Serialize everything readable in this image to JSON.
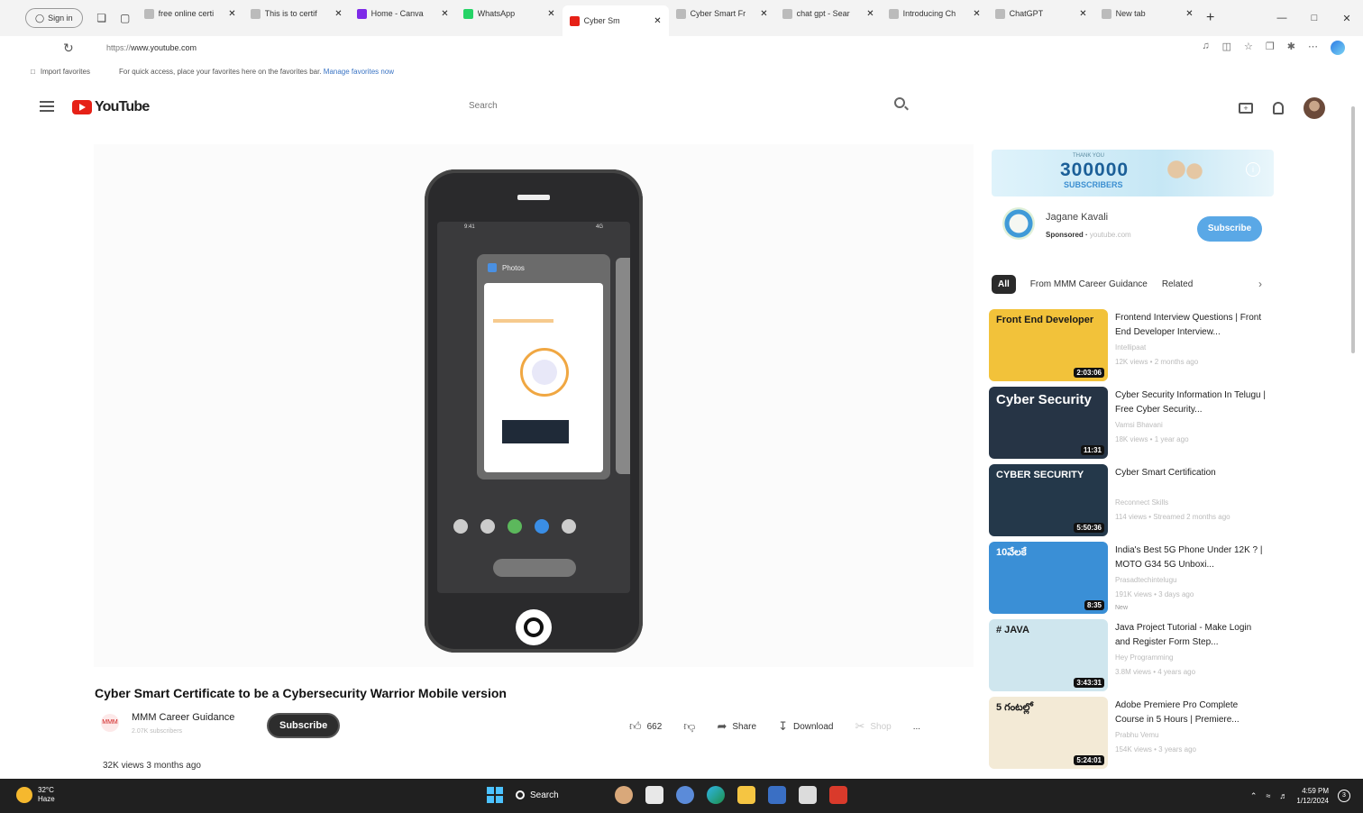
{
  "browser": {
    "signin_label": "Sign in",
    "tabs": [
      {
        "title": "free online certi",
        "favicon": "doc-icon",
        "active": false
      },
      {
        "title": "This is to certif",
        "favicon": "page-icon",
        "active": false
      },
      {
        "title": "Home - Canva",
        "favicon": "canva-icon",
        "active": false
      },
      {
        "title": "WhatsApp",
        "favicon": "whatsapp-icon",
        "active": false
      },
      {
        "title": "Cyber Sm",
        "favicon": "youtube-icon",
        "active": true
      },
      {
        "title": "Cyber Smart Fr",
        "favicon": "doc-icon",
        "active": false
      },
      {
        "title": "chat gpt - Sear",
        "favicon": "search-icon",
        "active": false
      },
      {
        "title": "Introducing Ch",
        "favicon": "page-icon",
        "active": false
      },
      {
        "title": "ChatGPT",
        "favicon": "chatgpt-icon",
        "active": false
      },
      {
        "title": "New tab",
        "favicon": "newtab-icon",
        "active": false
      }
    ],
    "url_prefix": "https://",
    "url_domain": "www.youtube.com",
    "favorites_import": "Import favorites",
    "favorites_hint": "For quick access, place your favorites here on the favorites bar.",
    "favorites_link": "Manage favorites now"
  },
  "youtube": {
    "logo_text": "YouTube",
    "search_placeholder": "Search",
    "video": {
      "title": "Cyber Smart Certificate to be a Cybersecurity Warrior Mobile version",
      "channel": "MMM Career Guidance",
      "channel_avatar_text": "MMM",
      "channel_subs": "2.07K subscribers",
      "subscribe_label": "Subscribe",
      "likes": "662",
      "share_label": "Share",
      "download_label": "Download",
      "shop_label": "Shop",
      "more_label": "...",
      "views": "32K views",
      "age": "3 months ago"
    },
    "phone_screen": {
      "status_left": "9:41",
      "status_right": "4G",
      "app_label": "Photos",
      "progress": 0.6
    },
    "ad": {
      "thank_you": "THANK YOU",
      "number": "300000",
      "subscribers": "SUBSCRIBERS",
      "info": "i",
      "sponsor_name": "Jagane Kavali",
      "sponsored": "Sponsored",
      "sponsor_domain": "youtube.com",
      "subscribe_label": "Subscribe"
    },
    "chips": [
      "All",
      "From MMM Career Guidance",
      "Related"
    ],
    "recommendations": [
      {
        "title": "Frontend Interview Questions | Front End Developer Interview...",
        "channel": "Intellipaat",
        "meta": "12K views • 2 months ago",
        "duration": "2:03:06",
        "thumb_text": "Front End Developer",
        "thumb_color": "#f2c23a"
      },
      {
        "title": "Cyber Security Information In Telugu | Free Cyber Security...",
        "channel": "Vamsi Bhavani",
        "meta": "18K views • 1 year ago",
        "duration": "11:31",
        "thumb_text": "Cyber Security",
        "thumb_color": "#263445"
      },
      {
        "title": "Cyber Smart Certification",
        "channel": "Reconnect Skills",
        "meta": "114 views • Streamed 2 months ago",
        "duration": "5:50:36",
        "thumb_text": "CYBER SECURITY",
        "thumb_color": "#24384a"
      },
      {
        "title": "India's Best 5G Phone Under 12K ? | MOTO G34 5G Unboxi...",
        "channel": "Prasadtechintelugu",
        "meta": "191K views • 3 days ago",
        "badge": "New",
        "duration": "8:35",
        "thumb_text": "10వేలకే",
        "thumb_color": "#3a8fd6"
      },
      {
        "title": "Java Project Tutorial - Make Login and Register Form Step...",
        "channel": "Hey Programming",
        "meta": "3.8M views • 4 years ago",
        "duration": "3:43:31",
        "thumb_text": "# JAVA",
        "thumb_color": "#cfe6ee"
      },
      {
        "title": "Adobe Premiere Pro Complete Course in 5 Hours | Premiere...",
        "channel": "Prabhu Vemu",
        "meta": "154K views • 3 years ago",
        "duration": "5:24:01",
        "thumb_text": "5 గంటల్లో",
        "thumb_color": "#f3ead6"
      }
    ]
  },
  "taskbar": {
    "temp": "32°C",
    "weather_label": "Haze",
    "search_label": "Search",
    "time": "4:59 PM",
    "date": "1/12/2024",
    "notification_count": "3"
  }
}
